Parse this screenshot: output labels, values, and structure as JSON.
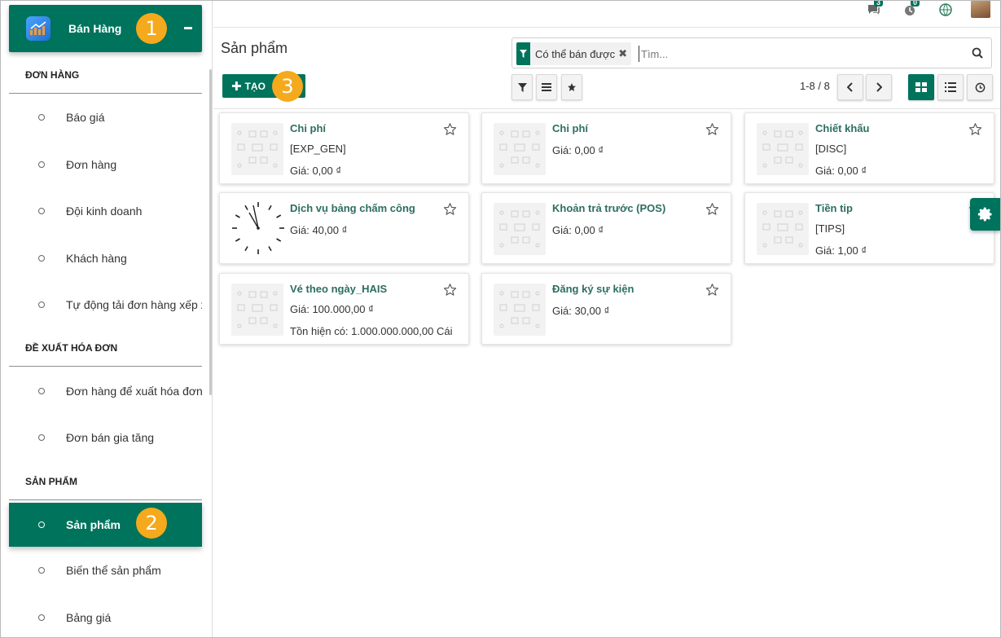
{
  "app": {
    "title": "Bán Hàng"
  },
  "callouts": [
    "1",
    "2",
    "3"
  ],
  "sidebar": {
    "sections": [
      {
        "heading": "ĐƠN HÀNG",
        "items": [
          "Báo giá",
          "Đơn hàng",
          "Đội kinh doanh",
          "Khách hàng",
          "Tự động tải đơn hàng xếp xe"
        ]
      },
      {
        "heading": "ĐỀ XUẤT HÓA ĐƠN",
        "items": [
          "Đơn hàng để xuất hóa đơn",
          "Đơn bán gia tăng"
        ]
      },
      {
        "heading": "SẢN PHẨM",
        "items": [
          "Sản phẩm",
          "Biến thể sản phẩm",
          "Bảng giá"
        ]
      }
    ],
    "active_item": "Sản phẩm"
  },
  "topbar": {
    "messages_count": "3",
    "activities_count": "0"
  },
  "control": {
    "page_title": "Sản phẩm",
    "create_label": "TẠO",
    "facet_label": "Có thể bán được",
    "search_placeholder": "Tìm...",
    "pager": "1-8 / 8"
  },
  "colors": {
    "brand": "#00735c",
    "callout": "#f5a91c",
    "product_name": "#2c6e60"
  },
  "products": [
    {
      "name": "Chi phí",
      "lines": [
        "[EXP_GEN]",
        "Giá: 0,00 ₫"
      ],
      "image": "placeholder"
    },
    {
      "name": "Chi phí",
      "lines": [
        "Giá: 0,00 ₫"
      ],
      "image": "placeholder"
    },
    {
      "name": "Chiết khấu",
      "lines": [
        "[DISC]",
        "Giá: 0,00 ₫"
      ],
      "image": "placeholder"
    },
    {
      "name": "Dịch vụ bảng chấm công",
      "lines": [
        "Giá: 40,00 ₫"
      ],
      "image": "clock"
    },
    {
      "name": "Khoản trả trước (POS)",
      "lines": [
        "Giá: 0,00 ₫"
      ],
      "image": "placeholder"
    },
    {
      "name": "Tiền tip",
      "lines": [
        "[TIPS]",
        "Giá: 1,00 ₫"
      ],
      "image": "placeholder"
    },
    {
      "name": "Vé theo ngày_HAIS",
      "lines": [
        "Giá: 100.000,00 ₫",
        "Tồn hiện có: 1.000.000.000,00 Cái"
      ],
      "image": "placeholder"
    },
    {
      "name": "Đăng ký sự kiện",
      "lines": [
        "Giá: 30,00 ₫"
      ],
      "image": "placeholder"
    }
  ]
}
